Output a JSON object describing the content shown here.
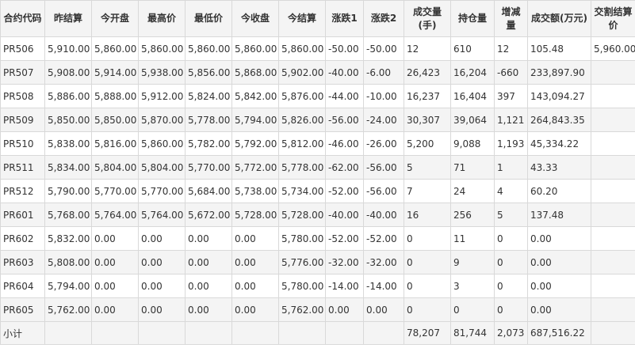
{
  "columns": [
    "合约代码",
    "昨结算",
    "今开盘",
    "最高价",
    "最低价",
    "今收盘",
    "今结算",
    "涨跌1",
    "涨跌2",
    "成交量(手)",
    "持仓量",
    "增减量",
    "成交额(万元)",
    "交割结算价"
  ],
  "rows": [
    [
      "PR506",
      "5,910.00",
      "5,860.00",
      "5,860.00",
      "5,860.00",
      "5,860.00",
      "5,860.00",
      "-50.00",
      "-50.00",
      "12",
      "610",
      "12",
      "105.48",
      "5,960.00"
    ],
    [
      "PR507",
      "5,908.00",
      "5,914.00",
      "5,938.00",
      "5,856.00",
      "5,868.00",
      "5,902.00",
      "-40.00",
      "-6.00",
      "26,423",
      "16,204",
      "-660",
      "233,897.90",
      ""
    ],
    [
      "PR508",
      "5,886.00",
      "5,888.00",
      "5,912.00",
      "5,824.00",
      "5,842.00",
      "5,876.00",
      "-44.00",
      "-10.00",
      "16,237",
      "16,404",
      "397",
      "143,094.27",
      ""
    ],
    [
      "PR509",
      "5,850.00",
      "5,850.00",
      "5,870.00",
      "5,778.00",
      "5,794.00",
      "5,826.00",
      "-56.00",
      "-24.00",
      "30,307",
      "39,064",
      "1,121",
      "264,843.35",
      ""
    ],
    [
      "PR510",
      "5,838.00",
      "5,816.00",
      "5,860.00",
      "5,782.00",
      "5,792.00",
      "5,812.00",
      "-46.00",
      "-26.00",
      "5,200",
      "9,088",
      "1,193",
      "45,334.22",
      ""
    ],
    [
      "PR511",
      "5,834.00",
      "5,804.00",
      "5,804.00",
      "5,770.00",
      "5,772.00",
      "5,778.00",
      "-62.00",
      "-56.00",
      "5",
      "71",
      "1",
      "43.33",
      ""
    ],
    [
      "PR512",
      "5,790.00",
      "5,770.00",
      "5,770.00",
      "5,684.00",
      "5,738.00",
      "5,734.00",
      "-52.00",
      "-56.00",
      "7",
      "24",
      "4",
      "60.20",
      ""
    ],
    [
      "PR601",
      "5,768.00",
      "5,764.00",
      "5,764.00",
      "5,672.00",
      "5,728.00",
      "5,728.00",
      "-40.00",
      "-40.00",
      "16",
      "256",
      "5",
      "137.48",
      ""
    ],
    [
      "PR602",
      "5,832.00",
      "0.00",
      "0.00",
      "0.00",
      "0.00",
      "5,780.00",
      "-52.00",
      "-52.00",
      "0",
      "11",
      "0",
      "0.00",
      ""
    ],
    [
      "PR603",
      "5,808.00",
      "0.00",
      "0.00",
      "0.00",
      "0.00",
      "5,776.00",
      "-32.00",
      "-32.00",
      "0",
      "9",
      "0",
      "0.00",
      ""
    ],
    [
      "PR604",
      "5,794.00",
      "0.00",
      "0.00",
      "0.00",
      "0.00",
      "5,780.00",
      "-14.00",
      "-14.00",
      "0",
      "3",
      "0",
      "0.00",
      ""
    ],
    [
      "PR605",
      "5,762.00",
      "0.00",
      "0.00",
      "0.00",
      "0.00",
      "5,762.00",
      "0.00",
      "0.00",
      "0",
      "0",
      "0",
      "0.00",
      ""
    ]
  ],
  "subtotal": [
    "小计",
    "",
    "",
    "",
    "",
    "",
    "",
    "",
    "",
    "78,207",
    "81,744",
    "2,073",
    "687,516.22",
    ""
  ]
}
